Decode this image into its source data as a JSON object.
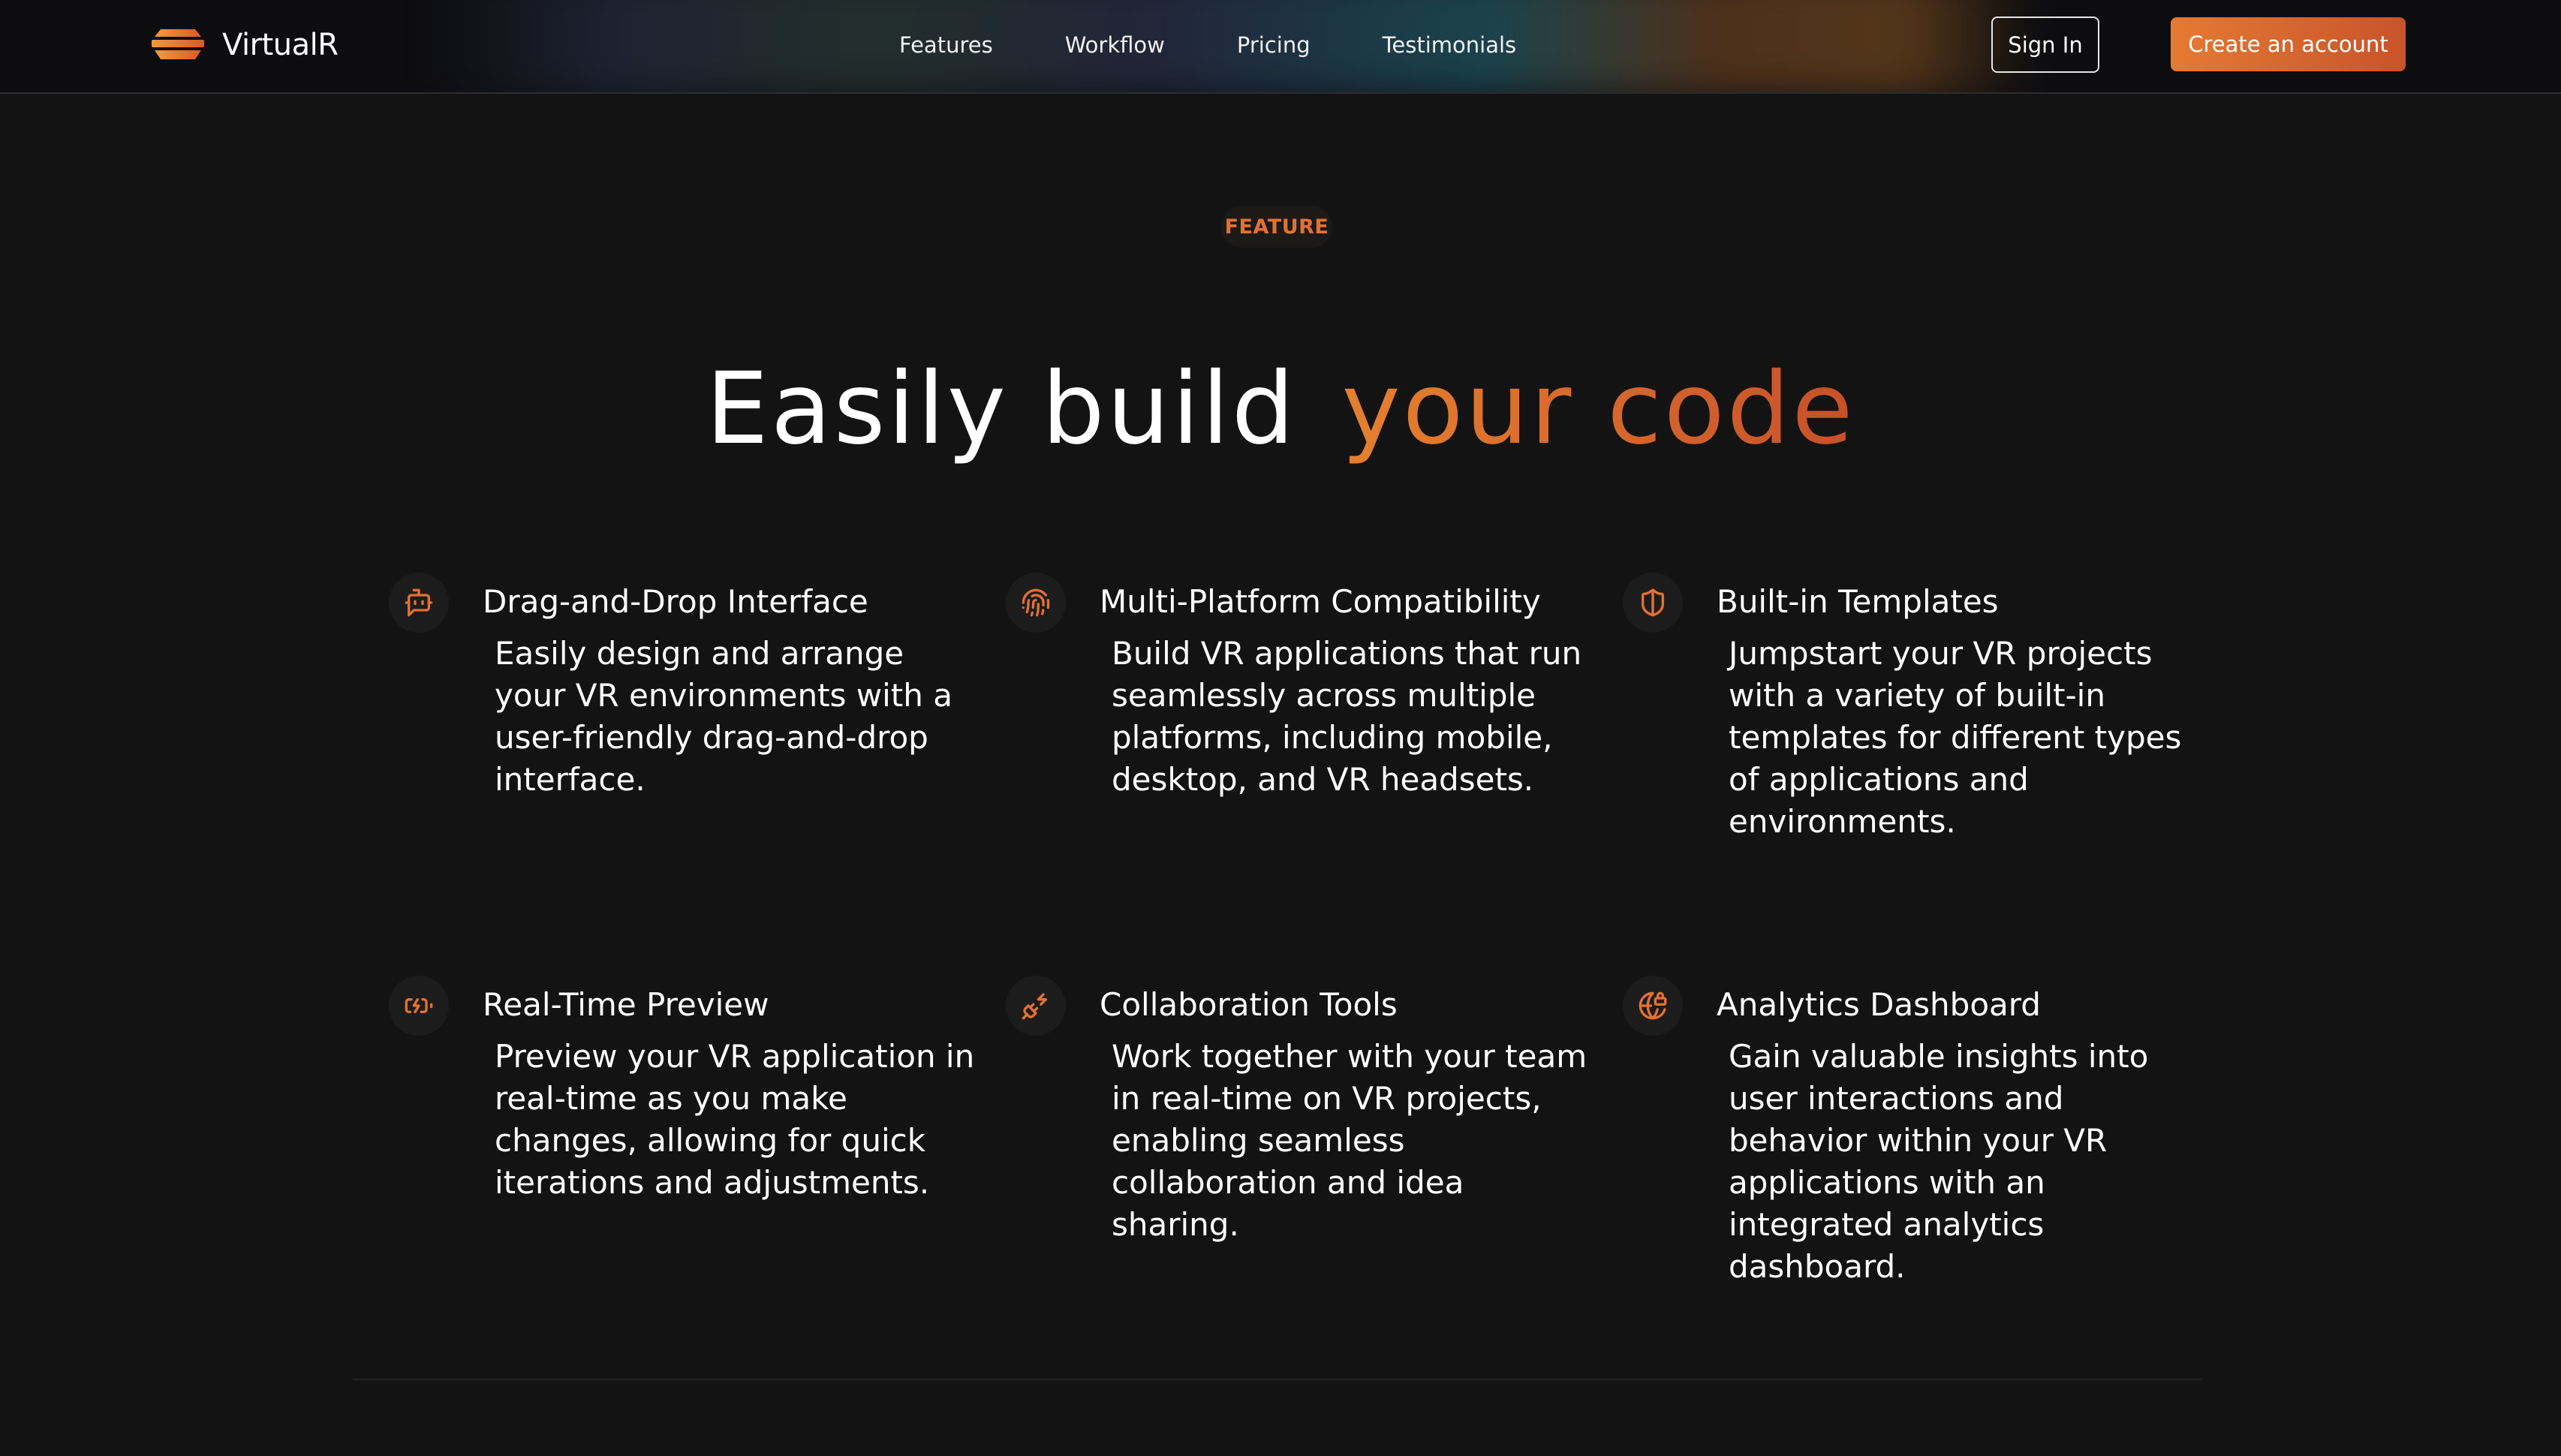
{
  "header": {
    "brand_name": "VirtualR",
    "nav": [
      "Features",
      "Workflow",
      "Pricing",
      "Testimonials"
    ],
    "sign_in_label": "Sign In",
    "create_account_label": "Create an account"
  },
  "hero": {
    "badge": "FEATURE",
    "headline_white": "Easily build",
    "headline_accent": "your code"
  },
  "features": [
    {
      "icon": "bot-icon",
      "title": "Drag-and-Drop Interface",
      "description": "Easily design and arrange your VR environments with a user-friendly drag-and-drop interface."
    },
    {
      "icon": "fingerprint-icon",
      "title": "Multi-Platform Compatibility",
      "description": "Build VR applications that run seamlessly across multiple platforms, including mobile, desktop, and VR headsets."
    },
    {
      "icon": "shield-half-icon",
      "title": "Built-in Templates",
      "description": "Jumpstart your VR projects with a variety of built-in templates for different types of applications and environments."
    },
    {
      "icon": "battery-charging-icon",
      "title": "Real-Time Preview",
      "description": "Preview your VR application in real-time as you make changes, allowing for quick iterations and adjustments."
    },
    {
      "icon": "plug-zap-icon",
      "title": "Collaboration Tools",
      "description": "Work together with your team in real-time on VR projects, enabling seamless collaboration and idea sharing."
    },
    {
      "icon": "globe-lock-icon",
      "title": "Analytics Dashboard",
      "description": "Gain valuable insights into user interactions and behavior within your VR applications with an integrated analytics dashboard."
    }
  ],
  "colors": {
    "background": "#131313",
    "accent": "#e4712f",
    "accent_dark": "#c8542a",
    "text": "#ffffff"
  }
}
